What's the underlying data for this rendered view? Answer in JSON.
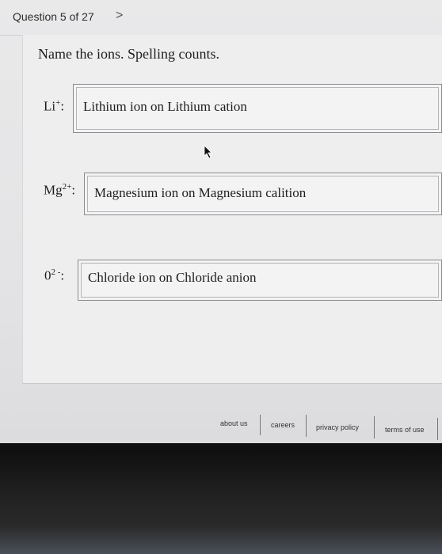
{
  "header": {
    "question_counter": "Question 5 of 27",
    "next_glyph": ">"
  },
  "question": {
    "prompt": "Name the ions. Spelling counts."
  },
  "ions": [
    {
      "symbol": "Li",
      "charge": "+",
      "answer": "Lithium ion on Lithium cation"
    },
    {
      "symbol": "Mg",
      "charge": "2+",
      "answer": "Magnesium ion on Magnesium calition"
    },
    {
      "symbol": "0",
      "charge": "2 -",
      "answer": "Chloride ion on Chloride anion"
    }
  ],
  "footer": {
    "links": [
      "about us",
      "careers",
      "privacy policy",
      "terms of use"
    ]
  }
}
